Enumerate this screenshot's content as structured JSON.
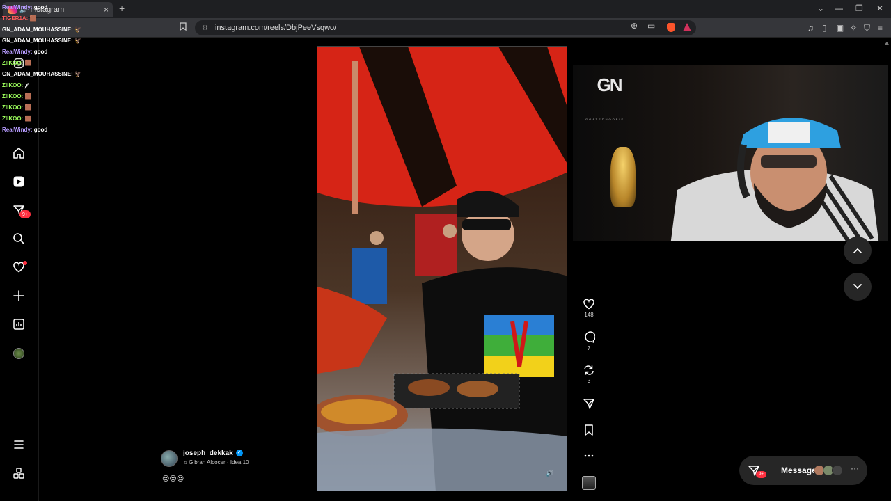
{
  "browser": {
    "tab_title": "Instagram",
    "new_tab": "+",
    "url": "instagram.com/reels/DbjPeeVsqwo/",
    "window_controls": [
      "⌄",
      "—",
      "❐",
      "✕"
    ]
  },
  "chat": [
    {
      "user": "RealWindy:",
      "msg": "good",
      "color": "#b79cff"
    },
    {
      "user": "TIGER1A:",
      "msg": "🟫",
      "color": "#ff5c5c"
    },
    {
      "user": "GN_ADAM_MOUHASSINE:",
      "msg": "🦅",
      "color": "#ffffff"
    },
    {
      "user": "GN_ADAM_MOUHASSINE:",
      "msg": "🦅",
      "color": "#ffffff"
    },
    {
      "user": "RealWindy:",
      "msg": "good",
      "color": "#b79cff"
    },
    {
      "user": "ZIIKOO:",
      "msg": "🟫",
      "color": "#9dff5c"
    },
    {
      "user": "GN_ADAM_MOUHASSINE:",
      "msg": "🦅",
      "color": "#ffffff"
    },
    {
      "user": "ZIIKOO:",
      "msg": "𝒻",
      "color": "#9dff5c"
    },
    {
      "user": "ZIIKOO:",
      "msg": "🟫",
      "color": "#9dff5c"
    },
    {
      "user": "ZIIKOO:",
      "msg": "🟫",
      "color": "#9dff5c"
    },
    {
      "user": "ZIIKOO:",
      "msg": "🟫",
      "color": "#9dff5c"
    },
    {
      "user": "RealWindy:",
      "msg": "good",
      "color": "#b79cff"
    }
  ],
  "sidebar": {
    "messages_badge": "9+"
  },
  "reel": {
    "likes": "148",
    "comments": "7",
    "reposts": "3",
    "author": "joseph_dekkak",
    "audio": "Gibran Alcocer · Idea 10",
    "caption": "😍😍😍"
  },
  "webcam": {
    "logo": "GN",
    "logo_sub": "GOATEDNOOBIE"
  },
  "messages": {
    "label": "Messages",
    "badge": "9+",
    "more": "···"
  }
}
